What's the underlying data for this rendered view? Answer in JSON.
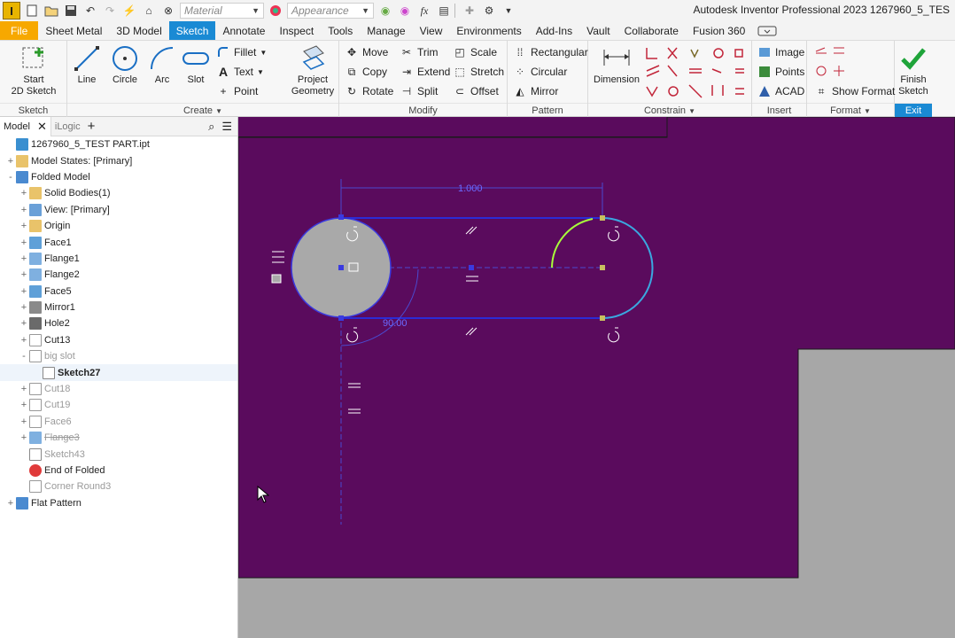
{
  "window": {
    "title": "Autodesk Inventor Professional 2023    1267960_5_TES",
    "logo_letter": "I"
  },
  "qat": {
    "material_placeholder": "Material",
    "appearance_placeholder": "Appearance",
    "fx_label": "fx"
  },
  "tabs": [
    "File",
    "Sheet Metal",
    "3D Model",
    "Sketch",
    "Annotate",
    "Inspect",
    "Tools",
    "Manage",
    "View",
    "Environments",
    "Add-Ins",
    "Vault",
    "Collaborate",
    "Fusion 360"
  ],
  "active_tab": "Sketch",
  "ribbon": {
    "sketch_panel": {
      "title": "Sketch",
      "start_sketch": "Start",
      "start_sketch2": "2D Sketch"
    },
    "create_panel": {
      "title": "Create",
      "line": "Line",
      "circle": "Circle",
      "arc": "Arc",
      "slot": "Slot",
      "fillet": "Fillet",
      "text": "Text",
      "point": "Point",
      "project": "Project",
      "project2": "Geometry"
    },
    "modify_panel": {
      "title": "Modify",
      "move": "Move",
      "copy": "Copy",
      "rotate": "Rotate",
      "trim": "Trim",
      "extend": "Extend",
      "split": "Split",
      "scale": "Scale",
      "stretch": "Stretch",
      "offset": "Offset"
    },
    "pattern_panel": {
      "title": "Pattern",
      "rectangular": "Rectangular",
      "circular": "Circular",
      "mirror": "Mirror"
    },
    "constrain_panel": {
      "title": "Constrain",
      "dimension": "Dimension"
    },
    "insert_panel": {
      "title": "Insert",
      "image": "Image",
      "points": "Points",
      "acad": "ACAD"
    },
    "format_panel": {
      "title": "Format",
      "show_format": "Show Format"
    },
    "exit_panel": {
      "title": "Exit",
      "finish": "Finish",
      "finish2": "Sketch"
    }
  },
  "browser": {
    "tab_model": "Model",
    "tab_ilogic": "iLogic",
    "tree": [
      {
        "label": "1267960_5_TEST PART.ipt",
        "level": 0,
        "exp": "",
        "icon": "part",
        "style": ""
      },
      {
        "label": "Model States: [Primary]",
        "level": 0,
        "exp": "+",
        "icon": "folder",
        "style": ""
      },
      {
        "label": "Folded Model",
        "level": 0,
        "exp": "-",
        "icon": "folded",
        "style": ""
      },
      {
        "label": "Solid Bodies(1)",
        "level": 1,
        "exp": "+",
        "icon": "folder",
        "style": ""
      },
      {
        "label": "View: [Primary]",
        "level": 1,
        "exp": "+",
        "icon": "view",
        "style": ""
      },
      {
        "label": "Origin",
        "level": 1,
        "exp": "+",
        "icon": "folder",
        "style": ""
      },
      {
        "label": "Face1",
        "level": 1,
        "exp": "+",
        "icon": "face",
        "style": ""
      },
      {
        "label": "Flange1",
        "level": 1,
        "exp": "+",
        "icon": "flange",
        "style": ""
      },
      {
        "label": "Flange2",
        "level": 1,
        "exp": "+",
        "icon": "flange",
        "style": ""
      },
      {
        "label": "Face5",
        "level": 1,
        "exp": "+",
        "icon": "face",
        "style": ""
      },
      {
        "label": "Mirror1",
        "level": 1,
        "exp": "+",
        "icon": "mirror",
        "style": ""
      },
      {
        "label": "Hole2",
        "level": 1,
        "exp": "+",
        "icon": "hole",
        "style": ""
      },
      {
        "label": "Cut13",
        "level": 1,
        "exp": "+",
        "icon": "cut",
        "style": ""
      },
      {
        "label": "big slot",
        "level": 1,
        "exp": "-",
        "icon": "cut",
        "style": "grey"
      },
      {
        "label": "Sketch27",
        "level": 2,
        "exp": "",
        "icon": "sketch",
        "style": "bold"
      },
      {
        "label": "Cut18",
        "level": 1,
        "exp": "+",
        "icon": "cut",
        "style": "grey"
      },
      {
        "label": "Cut19",
        "level": 1,
        "exp": "+",
        "icon": "cut",
        "style": "grey"
      },
      {
        "label": "Face6",
        "level": 1,
        "exp": "+",
        "icon": "cut",
        "style": "grey"
      },
      {
        "label": "Flange3",
        "level": 1,
        "exp": "+",
        "icon": "flange",
        "style": "grey strike"
      },
      {
        "label": "Sketch43",
        "level": 1,
        "exp": "",
        "icon": "sketch",
        "style": "grey"
      },
      {
        "label": "End of Folded",
        "level": 1,
        "exp": "",
        "icon": "end",
        "style": ""
      },
      {
        "label": "Corner Round3",
        "level": 1,
        "exp": "",
        "icon": "cut",
        "style": "grey"
      },
      {
        "label": "Flat Pattern",
        "level": 0,
        "exp": "+",
        "icon": "flat",
        "style": ""
      }
    ]
  },
  "sketch": {
    "dim_length": "1.000",
    "dim_angle": "90.00"
  },
  "colors": {
    "part_face": "#5a0b5d",
    "background": "#a7a7a7",
    "accent": "#1a8ad4",
    "file_tab": "#f7a800",
    "sketch_line": "#2b2bd6",
    "selected": "#a8ff3a"
  }
}
